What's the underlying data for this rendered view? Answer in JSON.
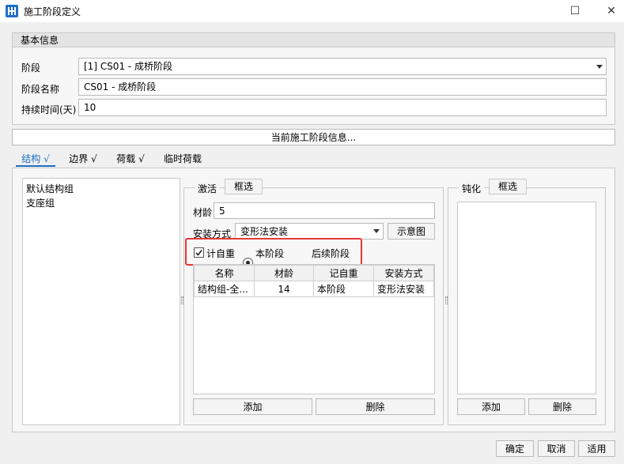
{
  "window": {
    "title": "施工阶段定义",
    "minimize": "☐",
    "close": "✕"
  },
  "basic_info": {
    "header": "基本信息",
    "stage_label": "阶段",
    "stage_value": "[1] CS01 - 成桥阶段",
    "stage_name_label": "阶段名称",
    "stage_name_value": "CS01 - 成桥阶段",
    "duration_label": "持续时间(天)",
    "duration_value": "10"
  },
  "current_stage_info_button": "当前施工阶段信息...",
  "tabs": [
    {
      "label": "结构 √",
      "active": true
    },
    {
      "label": "边界 √",
      "active": false
    },
    {
      "label": "荷载 √",
      "active": false
    },
    {
      "label": "临时荷载",
      "active": false
    }
  ],
  "group_list": [
    "默认结构组",
    "支座组"
  ],
  "activate": {
    "title": "激活",
    "box_select": "框选",
    "age_label": "材龄",
    "age_value": "5",
    "install_label": "安装方式",
    "install_value": "变形法安装",
    "diagram_button": "示意图",
    "self_weight_label": "计自重",
    "self_weight_checked": true,
    "radio_current": "本阶段",
    "radio_following": "后续阶段",
    "radio_selected": "current",
    "table": {
      "headers": [
        "名称",
        "材龄",
        "记自重",
        "安装方式"
      ],
      "rows": [
        [
          "结构组-全...",
          "14",
          "本阶段",
          "变形法安装"
        ]
      ]
    },
    "add_button": "添加",
    "delete_button": "删除"
  },
  "deactivate": {
    "title": "钝化",
    "box_select": "框选",
    "add_button": "添加",
    "delete_button": "删除"
  },
  "footer": {
    "ok": "确定",
    "cancel": "取消",
    "apply": "适用"
  },
  "colors": {
    "accent": "#1a6fc4",
    "highlight": "#e53935"
  }
}
